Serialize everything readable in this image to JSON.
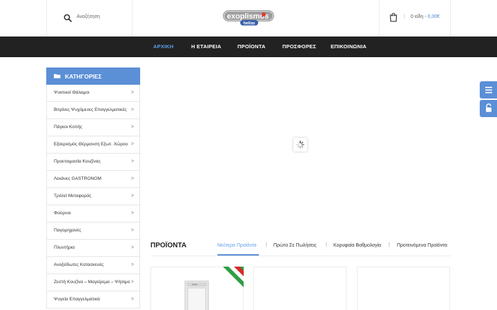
{
  "header": {
    "search_placeholder": "Αναζήτηση",
    "cart_separator": "|",
    "cart_items": "0 είδη -",
    "cart_total": "0,00€",
    "logo_text_main": "exoplismos",
    "logo_text_sub": "hellas"
  },
  "nav": {
    "items": [
      {
        "label": "ΑΡΧΙΚΗ",
        "active": true
      },
      {
        "label": "Η ΕΤΑΙΡΕΙΑ"
      },
      {
        "label": "ΠΡΟΪΟΝΤΑ"
      },
      {
        "label": "ΠΡΟΣΦΟΡΕΣ"
      },
      {
        "label": "ΕΠΙΚΟΙΝΩΝΙΑ"
      }
    ]
  },
  "sidebar": {
    "title": "ΚΑΤΗΓΟΡΙΕΣ",
    "items": [
      {
        "label": "Ψυκτικοί Θάλαμοι"
      },
      {
        "label": "Βιτρίνες Ψυχόμενες Επαγγελματικές"
      },
      {
        "label": "Πάγκοι Κοπής"
      },
      {
        "label": "Εξαερισμός Θέρμανση Εξωτ. Χώρου"
      },
      {
        "label": "Προετοιμασία Κουζίνας"
      },
      {
        "label": "Λεκάνες GASTRONOM"
      },
      {
        "label": "Τρόλεϊ Μεταφοράς"
      },
      {
        "label": "Φούρνοι"
      },
      {
        "label": "Παγομηχανές"
      },
      {
        "label": "Πλυντήρια"
      },
      {
        "label": "Ανοξείδωτες Κατασκευές"
      },
      {
        "label": "Ζεστή Κουζίνα – Μαγείρεμα – Ψήσιμο"
      },
      {
        "label": "Ψυγεία Επαγγελματικά"
      }
    ],
    "arrow": ">"
  },
  "products": {
    "title": "ΠΡΟΪΟΝΤΑ",
    "tabs": [
      {
        "label": "Νεότερα Προϊόντα",
        "active": true
      },
      {
        "label": "Πρώτα Σε Πωλήσεις"
      },
      {
        "label": "Κορυφαία Βαθμολογία"
      },
      {
        "label": "Προτεινόμενα Προϊόντα"
      }
    ],
    "tab_separator": "|"
  },
  "colors": {
    "accent": "#5b8fd6",
    "nav_bg": "#222222",
    "nav_active": "#5b9ee8",
    "flag_green": "#2e9e45",
    "flag_red": "#d62b2b"
  },
  "icons": {
    "search": "search-icon",
    "cart": "cart-icon",
    "folder": "folder-icon",
    "menu": "menu-icon",
    "lock": "lock-icon",
    "loader": "loader-icon"
  }
}
